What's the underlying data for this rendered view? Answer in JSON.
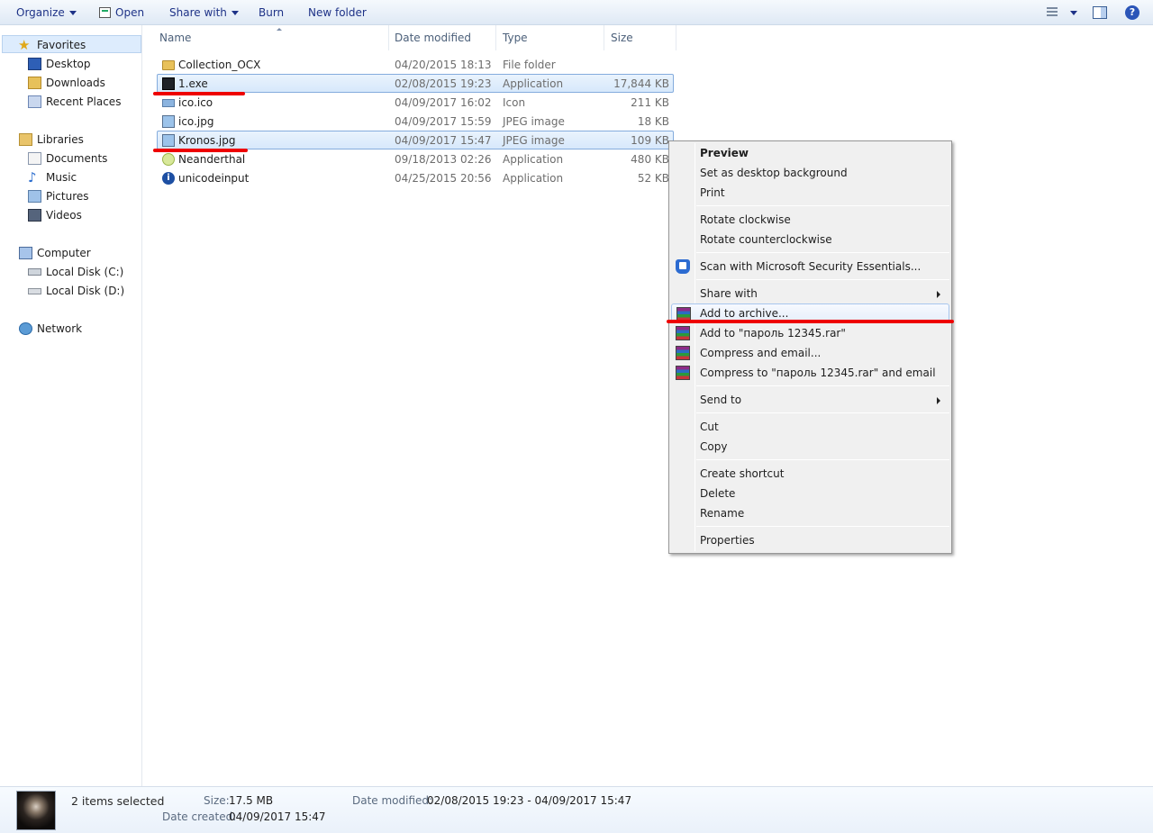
{
  "toolbar": {
    "organize": "Organize",
    "open": "Open",
    "share_with": "Share with",
    "burn": "Burn",
    "new_folder": "New folder",
    "help": "?"
  },
  "nav": {
    "favorites": "Favorites",
    "desktop": "Desktop",
    "downloads": "Downloads",
    "recent_places": "Recent Places",
    "libraries": "Libraries",
    "documents": "Documents",
    "music": "Music",
    "pictures": "Pictures",
    "videos": "Videos",
    "computer": "Computer",
    "local_disk_c": "Local Disk (C:)",
    "local_disk_d": "Local Disk (D:)",
    "network": "Network"
  },
  "columns": {
    "name": "Name",
    "date": "Date modified",
    "type": "Type",
    "size": "Size"
  },
  "files": [
    {
      "name": "Collection_OCX",
      "date": "04/20/2015 18:13",
      "type": "File folder",
      "size": "",
      "icon": "folder-icon"
    },
    {
      "name": "1.exe",
      "date": "02/08/2015 19:23",
      "type": "Application",
      "size": "17,844 KB",
      "icon": "exe-icon"
    },
    {
      "name": "ico.ico",
      "date": "04/09/2017 16:02",
      "type": "Icon",
      "size": "211 KB",
      "icon": "ico-file-icon"
    },
    {
      "name": "ico.jpg",
      "date": "04/09/2017 15:59",
      "type": "JPEG image",
      "size": "18 KB",
      "icon": "image-icon"
    },
    {
      "name": "Kronos.jpg",
      "date": "04/09/2017 15:47",
      "type": "JPEG image",
      "size": "109 KB",
      "icon": "image-icon"
    },
    {
      "name": "Neanderthal",
      "date": "09/18/2013 02:26",
      "type": "Application",
      "size": "480 KB",
      "icon": "app-icon"
    },
    {
      "name": "unicodeinput",
      "date": "04/25/2015 20:56",
      "type": "Application",
      "size": "52 KB",
      "icon": "info-icon"
    }
  ],
  "context_menu": {
    "preview": "Preview",
    "set_desktop_bg": "Set as desktop background",
    "print": "Print",
    "rotate_cw": "Rotate clockwise",
    "rotate_ccw": "Rotate counterclockwise",
    "scan_mse": "Scan with Microsoft Security Essentials...",
    "share_with": "Share with",
    "add_to_archive": "Add to archive...",
    "add_to_rar": "Add to \"пароль 12345.rar\"",
    "compress_email": "Compress and email...",
    "compress_rar_email": "Compress to \"пароль 12345.rar\" and email",
    "send_to": "Send to",
    "cut": "Cut",
    "copy": "Copy",
    "create_shortcut": "Create shortcut",
    "delete": "Delete",
    "rename": "Rename",
    "properties": "Properties"
  },
  "details": {
    "selected": "2 items selected",
    "size_label": "Size:",
    "size_value": "17.5 MB",
    "date_modified_label": "Date modified:",
    "date_modified_value": "02/08/2015 19:23 - 04/09/2017 15:47",
    "date_created_label": "Date created:",
    "date_created_value": "04/09/2017 15:47"
  },
  "colors": {
    "annotation_red": "#ee0000",
    "selection_border": "#84acdd",
    "toolbar_text": "#1e3287"
  }
}
